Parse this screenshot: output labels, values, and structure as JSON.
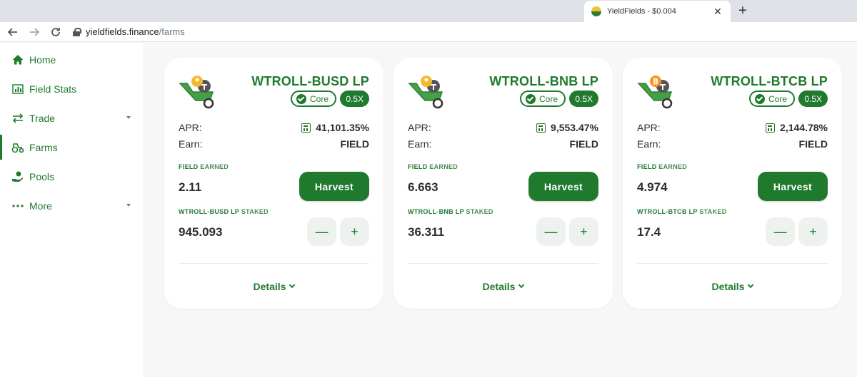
{
  "browser": {
    "tab_title": "YieldFields - $0.004",
    "tab_close": "✕",
    "new_tab": "+",
    "url_host": "yieldfields.finance",
    "url_path": "/farms"
  },
  "sidebar": {
    "items": [
      {
        "label": "Home",
        "icon": "home-icon"
      },
      {
        "label": "Field Stats",
        "icon": "chart-icon"
      },
      {
        "label": "Trade",
        "icon": "swap-icon"
      },
      {
        "label": "Farms",
        "icon": "tractor-icon"
      },
      {
        "label": "Pools",
        "icon": "hand-coin-icon"
      },
      {
        "label": "More",
        "icon": "more-dots-icon"
      }
    ],
    "active": "Farms"
  },
  "labels": {
    "apr": "APR:",
    "earn": "Earn:",
    "earned_token": "FIELD",
    "earned_suffix": " EARNED",
    "staked_suffix": " STAKED",
    "harvest": "Harvest",
    "details": "Details",
    "core": "Core",
    "minus": "—",
    "plus": "+"
  },
  "farms": [
    {
      "name": "WTROLL-BUSD LP",
      "multiplier": "0.5X",
      "apr": "41,101.35%",
      "earn": "FIELD",
      "earned": "2.11",
      "staked_label": "WTROLL-BUSD LP",
      "staked": "945.093",
      "coin_color": "#f3ba2f"
    },
    {
      "name": "WTROLL-BNB LP",
      "multiplier": "0.5X",
      "apr": "9,553.47%",
      "earn": "FIELD",
      "earned": "6.663",
      "staked_label": "WTROLL-BNB LP",
      "staked": "36.311",
      "coin_color": "#f3ba2f"
    },
    {
      "name": "WTROLL-BTCB LP",
      "multiplier": "0.5X",
      "apr": "2,144.78%",
      "earn": "FIELD",
      "earned": "4.974",
      "staked_label": "WTROLL-BTCB LP",
      "staked": "17.4",
      "coin_color": "#f7931a"
    }
  ],
  "colors": {
    "brand_green": "#1f7a2e",
    "background": "#f7f7f7"
  }
}
